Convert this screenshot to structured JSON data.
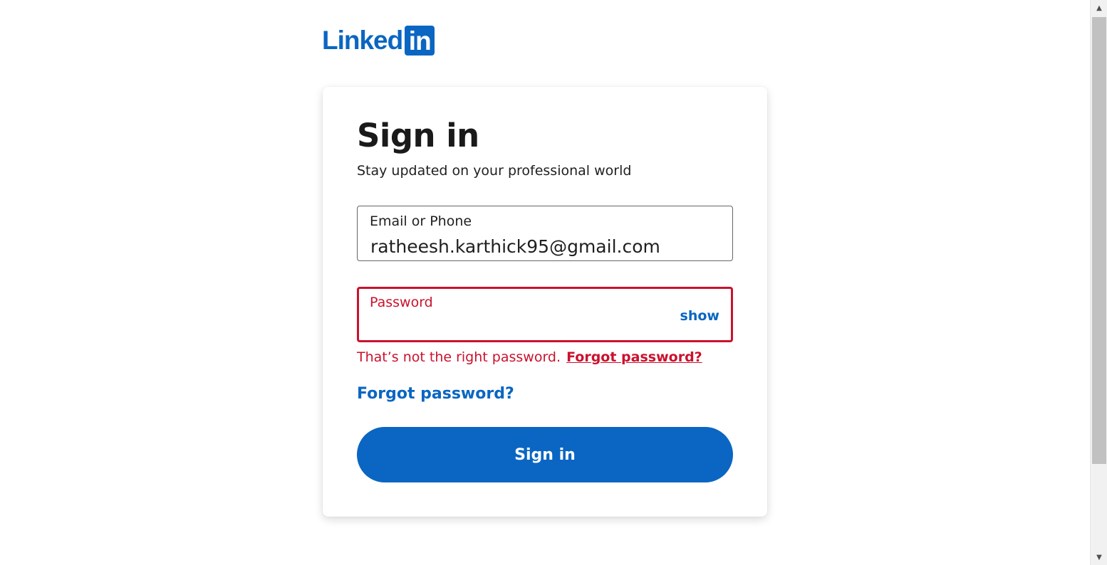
{
  "logo": {
    "text": "Linked",
    "box_text": "in",
    "color": "#0a66c2"
  },
  "signin": {
    "title": "Sign in",
    "subtitle": "Stay updated on your professional world",
    "email_label": "Email or Phone",
    "email_value": "ratheesh.karthick95@gmail.com",
    "password_label": "Password",
    "password_value": "",
    "show_label": "show",
    "error_text": "That’s not the right password.",
    "error_link": "Forgot password?",
    "forgot_link": "Forgot password?",
    "submit_label": "Sign in"
  },
  "colors": {
    "accent": "#0a66c2",
    "error": "#cb112d"
  },
  "scrollbar": {
    "up_icon": "▲",
    "down_icon": "▼"
  }
}
